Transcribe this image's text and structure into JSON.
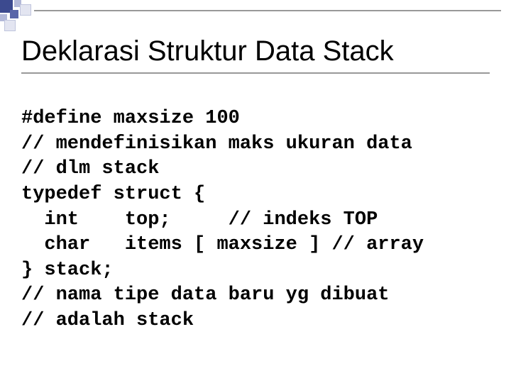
{
  "title": "Deklarasi Struktur Data Stack",
  "code": {
    "l1": "#define maxsize 100",
    "l2": "// mendefinisikan maks ukuran data",
    "l3": "// dlm stack",
    "l4": "typedef struct {",
    "l5": "  int    top;     // indeks TOP",
    "l6": "  char   items [ maxsize ] // array",
    "l7": "} stack;",
    "l8": "// nama tipe data baru yg dibuat",
    "l9": "// adalah stack"
  }
}
